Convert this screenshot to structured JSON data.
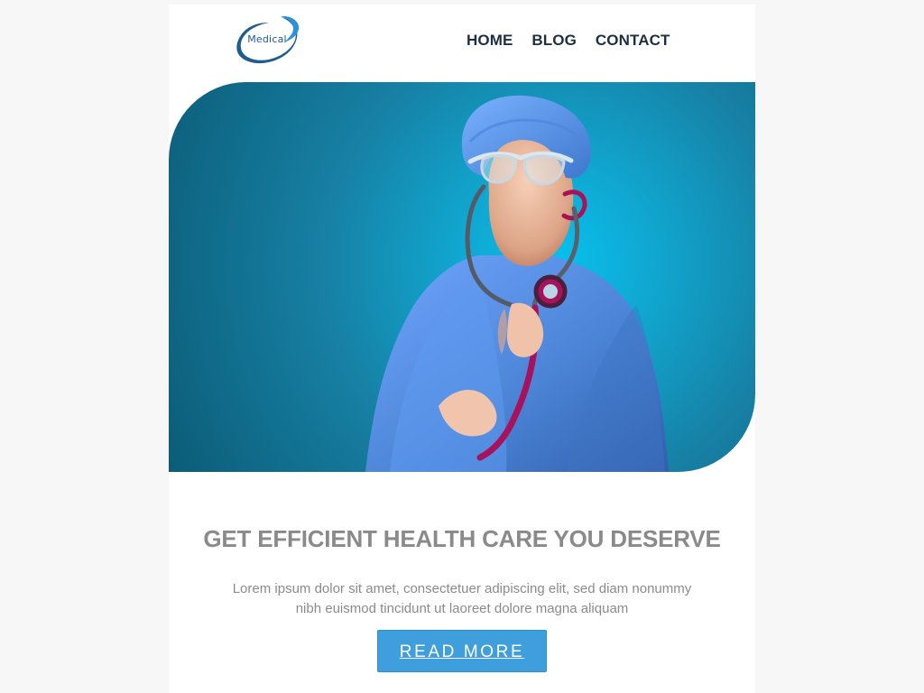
{
  "header": {
    "logo_text": "Medical",
    "nav": [
      "HOME",
      "BLOG",
      "CONTACT"
    ]
  },
  "hero": {
    "image_name": "doctor-with-stethoscope-image"
  },
  "content": {
    "headline": "GET EFFICIENT HEALTH CARE YOU DESERVE",
    "body": "Lorem ipsum dolor sit amet, consectetuer adipiscing elit, sed diam nonummy nibh euismod tincidunt ut laoreet dolore magna aliquam",
    "button_label": "READ MORE"
  },
  "colors": {
    "page_background": "#f7f7f7",
    "panel_background": "#ffffff",
    "navigation_text": "#1e2f44",
    "logo_blue": "#1f5d8e",
    "hero_cyan": "#08c0ed",
    "hero_deep_teal": "#0b5c77",
    "headline_gray": "#8a8a8a",
    "button_blue": "#3f9fdd"
  }
}
